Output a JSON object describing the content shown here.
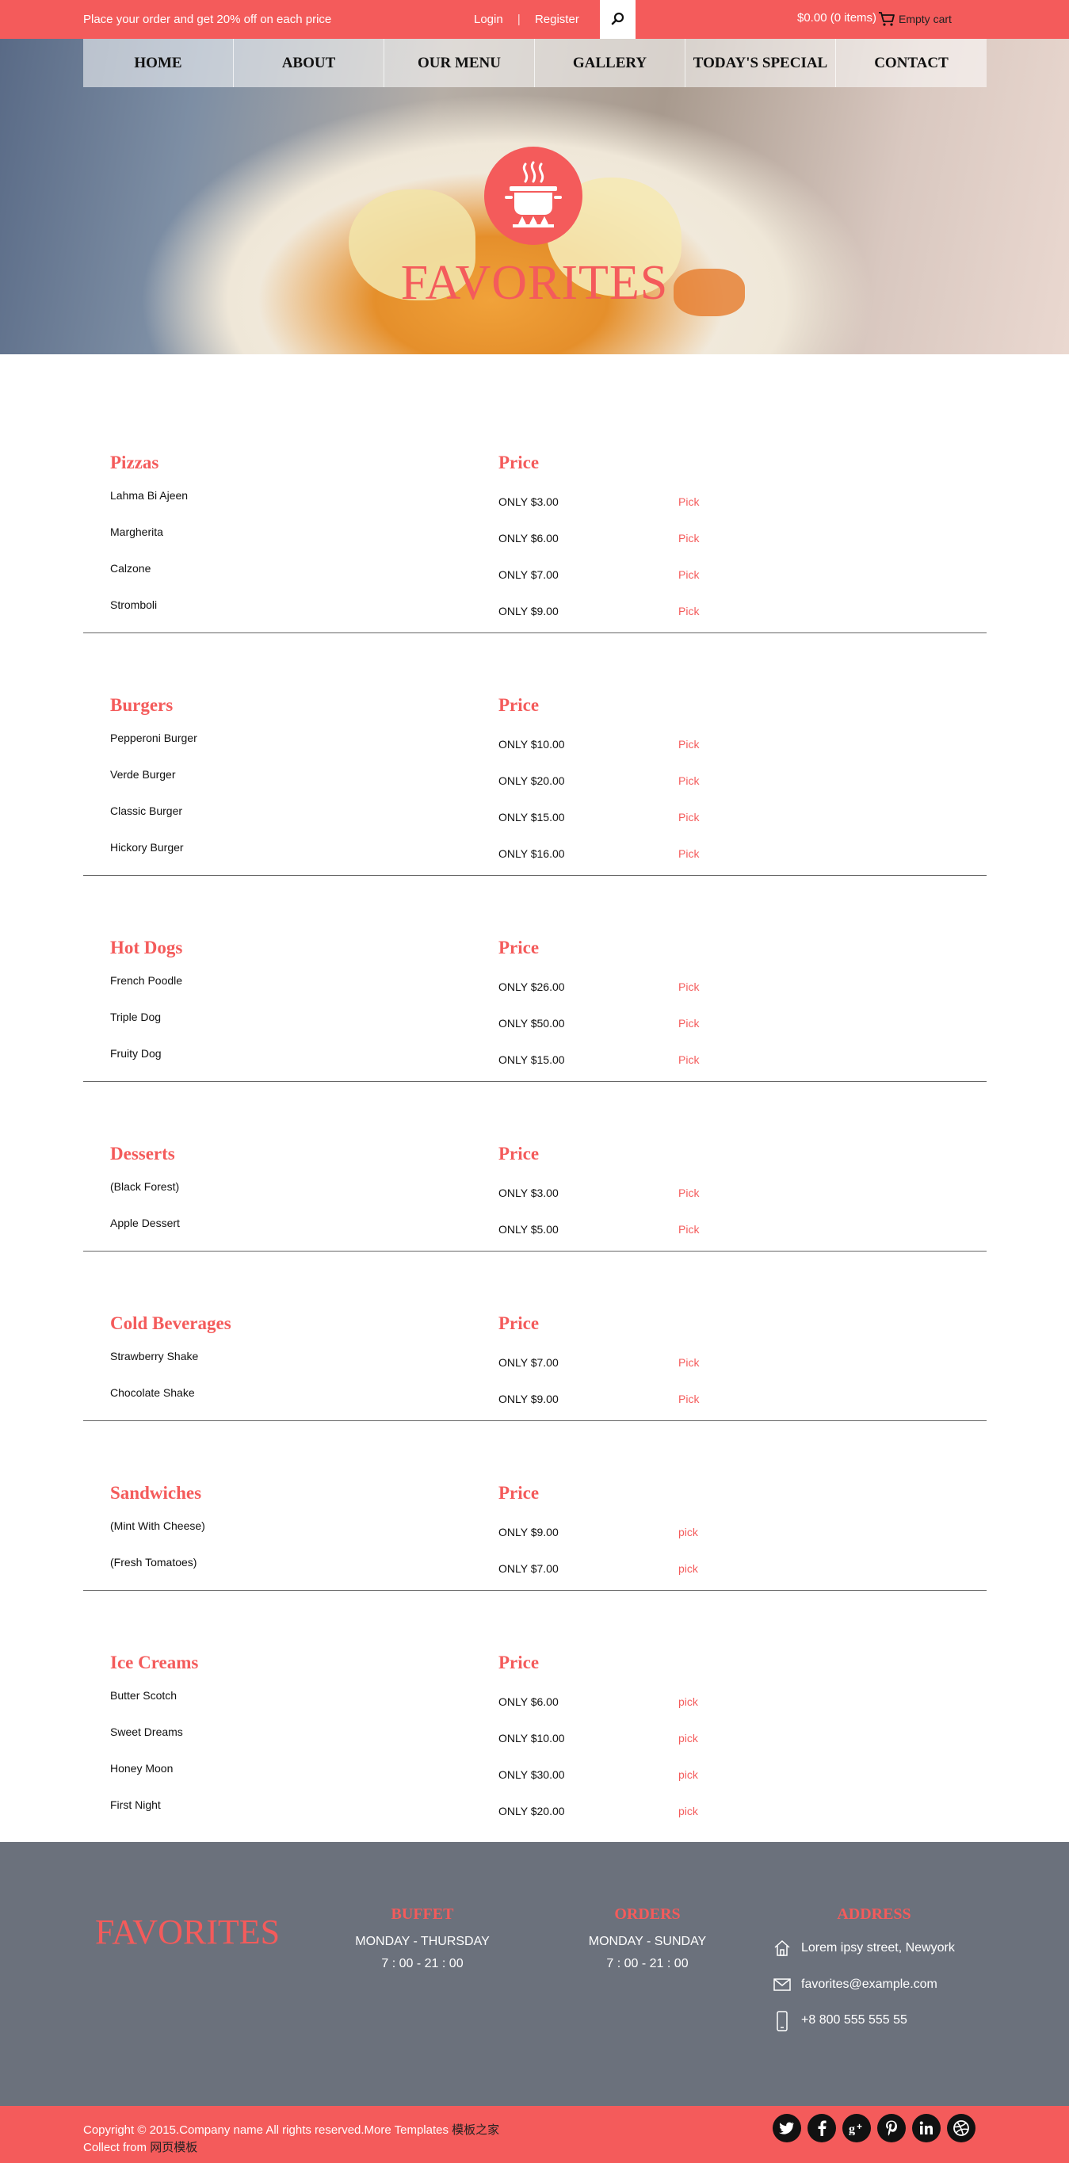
{
  "topbar": {
    "promo": "Place your order and get 20% off on each price",
    "login": "Login",
    "separator": "|",
    "register": "Register",
    "cart_total": "$0.00 (0 items)",
    "cart_text": "Empty cart"
  },
  "nav": [
    "HOME",
    "ABOUT",
    "OUR MENU",
    "GALLERY",
    "TODAY'S SPECIAL",
    "CONTACT"
  ],
  "hero": {
    "title": "FAVORITES"
  },
  "menu": [
    {
      "category": "Pizzas",
      "price_heading": "Price",
      "items": [
        {
          "name": "Lahma Bi Ajeen",
          "price": "ONLY $3.00",
          "action": "Pick"
        },
        {
          "name": "Margherita",
          "price": "ONLY $6.00",
          "action": "Pick"
        },
        {
          "name": "Calzone",
          "price": "ONLY $7.00",
          "action": "Pick"
        },
        {
          "name": "Stromboli",
          "price": "ONLY $9.00",
          "action": "Pick"
        }
      ]
    },
    {
      "category": "Burgers",
      "price_heading": "Price",
      "items": [
        {
          "name": "Pepperoni Burger",
          "price": "ONLY $10.00",
          "action": "Pick"
        },
        {
          "name": "Verde Burger",
          "price": "ONLY $20.00",
          "action": "Pick"
        },
        {
          "name": "Classic Burger",
          "price": "ONLY $15.00",
          "action": "Pick"
        },
        {
          "name": "Hickory Burger",
          "price": "ONLY $16.00",
          "action": "Pick"
        }
      ]
    },
    {
      "category": "Hot Dogs",
      "price_heading": "Price",
      "items": [
        {
          "name": "French Poodle",
          "price": "ONLY $26.00",
          "action": "Pick"
        },
        {
          "name": "Triple Dog",
          "price": "ONLY $50.00",
          "action": "Pick"
        },
        {
          "name": "Fruity Dog",
          "price": "ONLY $15.00",
          "action": "Pick"
        }
      ]
    },
    {
      "category": "Desserts",
      "price_heading": "Price",
      "items": [
        {
          "name": "(Black Forest)",
          "price": "ONLY $3.00",
          "action": "Pick"
        },
        {
          "name": "Apple Dessert",
          "price": "ONLY $5.00",
          "action": "Pick"
        }
      ]
    },
    {
      "category": "Cold Beverages",
      "price_heading": "Price",
      "items": [
        {
          "name": "Strawberry Shake",
          "price": "ONLY $7.00",
          "action": "Pick"
        },
        {
          "name": "Chocolate Shake",
          "price": "ONLY $9.00",
          "action": "Pick"
        }
      ]
    },
    {
      "category": "Sandwiches",
      "price_heading": "Price",
      "items": [
        {
          "name": "(Mint With Cheese)",
          "price": "ONLY $9.00",
          "action": "pick"
        },
        {
          "name": "(Fresh Tomatoes)",
          "price": "ONLY $7.00",
          "action": "pick"
        }
      ]
    },
    {
      "category": "Ice Creams",
      "price_heading": "Price",
      "items": [
        {
          "name": "Butter Scotch",
          "price": "ONLY $6.00",
          "action": "pick"
        },
        {
          "name": "Sweet Dreams",
          "price": "ONLY $10.00",
          "action": "pick"
        },
        {
          "name": "Honey Moon",
          "price": "ONLY $30.00",
          "action": "pick"
        },
        {
          "name": "First Night",
          "price": "ONLY $20.00",
          "action": "pick"
        }
      ]
    }
  ],
  "footer": {
    "logo": "FAVORITES",
    "buffet": {
      "heading": "BUFFET",
      "days": "MONDAY - THURSDAY",
      "hours": "7 : 00 - 21 : 00"
    },
    "orders": {
      "heading": "ORDERS",
      "days": "MONDAY - SUNDAY",
      "hours": "7 : 00 - 21 : 00"
    },
    "address": {
      "heading": "ADDRESS",
      "street": "Lorem ipsy street, Newyork",
      "email": "favorites@example.com",
      "phone": "+8 800 555 555 55"
    }
  },
  "bottombar": {
    "copyright": "Copyright © 2015.Company name All rights reserved.More Templates",
    "link1": "模板之家",
    "collect": "Collect from",
    "link2": "网页模板",
    "social": [
      "twitter-icon",
      "facebook-icon",
      "google-plus-icon",
      "pinterest-icon",
      "linkedin-icon",
      "dribbble-icon"
    ]
  },
  "colors": {
    "accent": "#f45b5b",
    "footer_bg": "#6b717c"
  }
}
